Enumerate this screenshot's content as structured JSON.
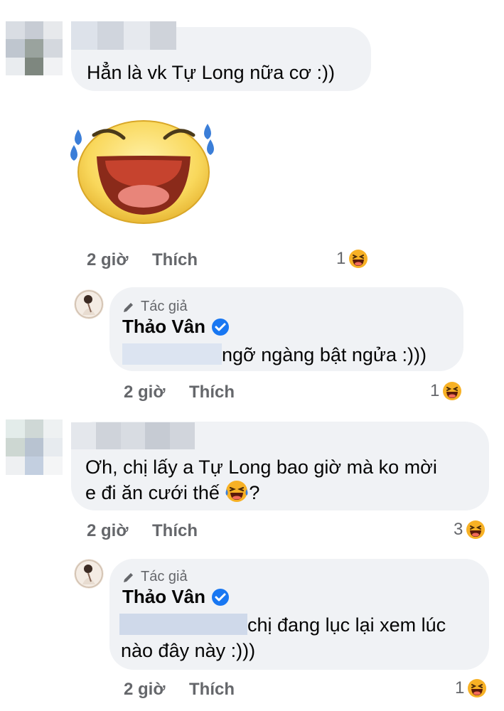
{
  "comments": [
    {
      "text": "Hẳn là vk Tự Long nữa cơ :))",
      "time": "2 giờ",
      "like_label": "Thích",
      "reaction_count": "1",
      "reaction_icon": "haha-emoji-icon",
      "sticker": "laughing-face-sticker"
    },
    {
      "author_badge": "Tác giả",
      "author_name": "Thảo Vân",
      "text": "ngỡ ngàng bật ngửa :)))",
      "time": "2 giờ",
      "like_label": "Thích",
      "reaction_count": "1",
      "reaction_icon": "haha-emoji-icon"
    },
    {
      "text_line1": "Ơh, chị lấy a Tự Long bao giờ mà ko mời",
      "text_line2": "e đi ăn cưới thế",
      "text_line2_suffix": "?",
      "time": "2 giờ",
      "like_label": "Thích",
      "reaction_count": "3",
      "reaction_icon": "haha-emoji-icon"
    },
    {
      "author_badge": "Tác giả",
      "author_name": "Thảo Vân",
      "text_line1": "chị đang lục lại xem lúc",
      "text_line2": "nào đây này :)))",
      "time": "2 giờ",
      "like_label": "Thích",
      "reaction_count": "1",
      "reaction_icon": "haha-emoji-icon"
    }
  ],
  "colors": {
    "bubble": "#f0f2f5",
    "meta_text": "#65676b",
    "verified": "#1877f2",
    "haha": "#f7b125"
  }
}
